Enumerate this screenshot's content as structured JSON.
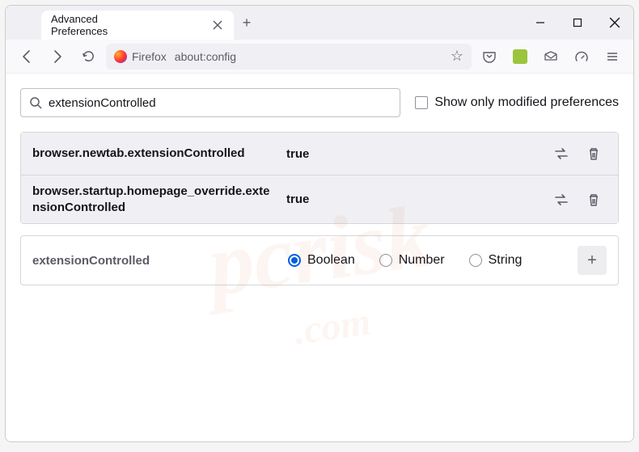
{
  "window": {
    "tab_title": "Advanced Preferences"
  },
  "toolbar": {
    "identity_label": "Firefox",
    "url": "about:config"
  },
  "search": {
    "value": "extensionControlled",
    "checkbox_label": "Show only modified preferences"
  },
  "prefs": [
    {
      "name": "browser.newtab.extensionControlled",
      "value": "true"
    },
    {
      "name": "browser.startup.homepage_override.extensionControlled",
      "value": "true"
    }
  ],
  "new_pref": {
    "name": "extensionControlled",
    "types": [
      "Boolean",
      "Number",
      "String"
    ],
    "selected": "Boolean"
  },
  "watermark": {
    "main": "pcrisk",
    "sub": ".com"
  }
}
